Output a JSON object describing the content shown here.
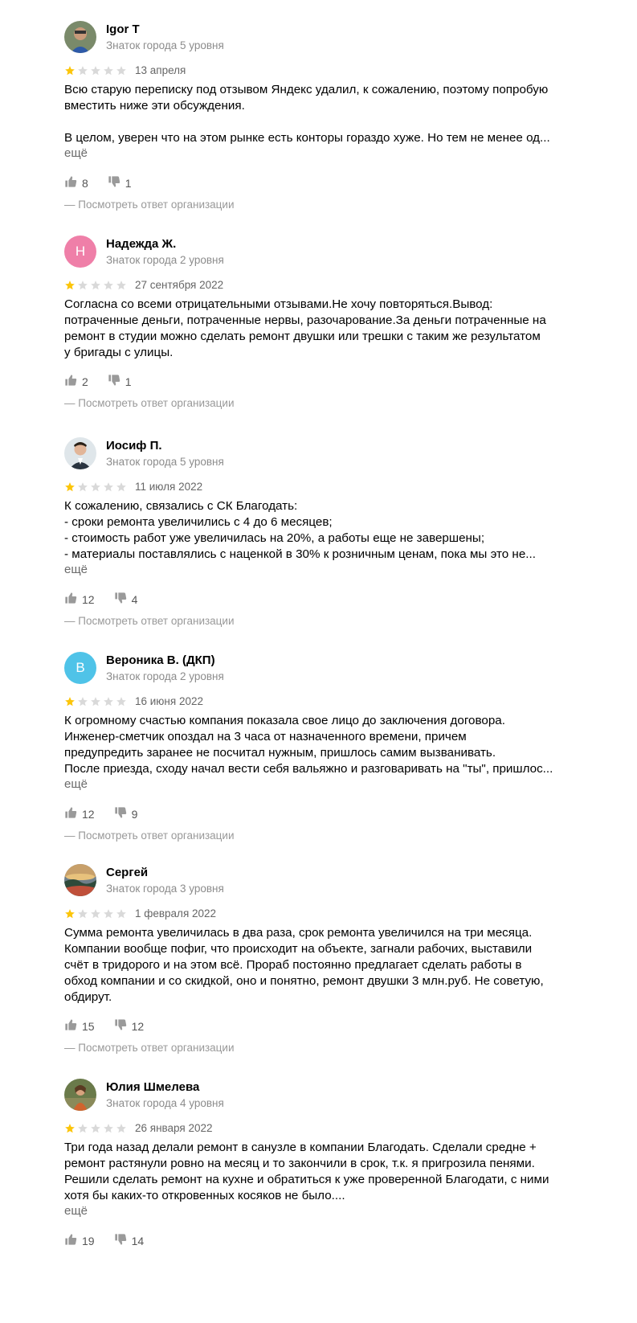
{
  "more_label": "ещё",
  "answer_label": "—  Посмотреть ответ организации",
  "star_colors": {
    "filled": "#fcc50a",
    "empty": "#d9d9d9"
  },
  "reviews": [
    {
      "author": "Igor T",
      "level": "Знаток города 5 уровня",
      "avatar": {
        "type": "photo",
        "icon": "person-photo-icon"
      },
      "rating": 1,
      "date": "13 апреля",
      "text_lines": [
        "Всю старую переписку под отзывом Яндекс удалил, к сожалению, поэтому попробую",
        "вместить ниже эти обсуждения.",
        "",
        "В целом, уверен что на этом рынке есть конторы гораздо хуже. Но тем не менее од..."
      ],
      "has_more": true,
      "likes": "8",
      "dislikes": "1"
    },
    {
      "author": "Надежда Ж.",
      "level": "Знаток города 2 уровня",
      "avatar": {
        "type": "letter",
        "letter": "Н",
        "color": "#ef7fa8"
      },
      "rating": 1,
      "date": "27 сентября 2022",
      "text_lines": [
        "Согласна со всеми отрицательными отзывами.Не хочу повторяться.Вывод:",
        "потраченные деньги, потраченные нервы, разочарование.За деньги потраченные на",
        "ремонт в студии можно сделать ремонт двушки или трешки с таким же результатом",
        "у бригады с улицы."
      ],
      "has_more": false,
      "likes": "2",
      "dislikes": "1"
    },
    {
      "author": "Иосиф П.",
      "level": "Знаток города 5 уровня",
      "avatar": {
        "type": "photo",
        "icon": "person-photo-icon"
      },
      "rating": 1,
      "date": "11 июля 2022",
      "text_lines": [
        "К сожалению, связались с СК Благодать:",
        "- сроки ремонта увеличились с 4 до 6 месяцев;",
        "- стоимость работ уже увеличилась на 20%, а работы еще не завершены;",
        "- материалы поставлялись с наценкой в 30% к розничным ценам, пока мы это не..."
      ],
      "has_more": true,
      "likes": "12",
      "dislikes": "4"
    },
    {
      "author": "Вероника В. (ДКП)",
      "level": "Знаток города 2 уровня",
      "avatar": {
        "type": "letter",
        "letter": "В",
        "color": "#4fc3e8"
      },
      "rating": 1,
      "date": "16 июня 2022",
      "text_lines": [
        "К огромному счастью компания показала свое лицо до заключения договора.",
        "Инженер-сметчик опоздал на 3 часа от назначенного времени, причем",
        "предупредить заранее не посчитал нужным, пришлось самим вызванивать.",
        "После приезда, сходу начал вести себя вальяжно и разговаривать на \"ты\", пришлос..."
      ],
      "has_more": true,
      "likes": "12",
      "dislikes": "9"
    },
    {
      "author": "Сергей",
      "level": "Знаток города 3 уровня",
      "avatar": {
        "type": "photo",
        "icon": "landscape-photo-icon"
      },
      "rating": 1,
      "date": "1 февраля 2022",
      "text_lines": [
        "Сумма ремонта увеличилась в два раза, срок ремонта увеличился на три месяца.",
        "Компании вообще пофиг, что происходит на объекте, загнали рабочих, выставили",
        "счёт в тридорого и на этом всё. Прораб постоянно предлагает сделать работы в",
        "обход компании и со скидкой, оно и понятно, ремонт двушки 3 млн.руб. Не советую,",
        "обдирут."
      ],
      "has_more": false,
      "likes": "15",
      "dislikes": "12"
    },
    {
      "author": "Юлия Шмелева",
      "level": "Знаток города 4 уровня",
      "avatar": {
        "type": "photo",
        "icon": "person-photo-icon"
      },
      "rating": 1,
      "date": "26 января 2022",
      "text_lines": [
        "Три года назад делали ремонт в санузле в компании Благодать. Сделали средне +",
        "ремонт растянули ровно на месяц и то закончили в срок, т.к. я пригрозила пенями.",
        "Решили сделать ремонт на кухне и обратиться к уже проверенной Благодати, с ними",
        "хотя бы каких-то откровенных косяков не было...."
      ],
      "has_more": true,
      "likes": "19",
      "dislikes": "14"
    }
  ]
}
